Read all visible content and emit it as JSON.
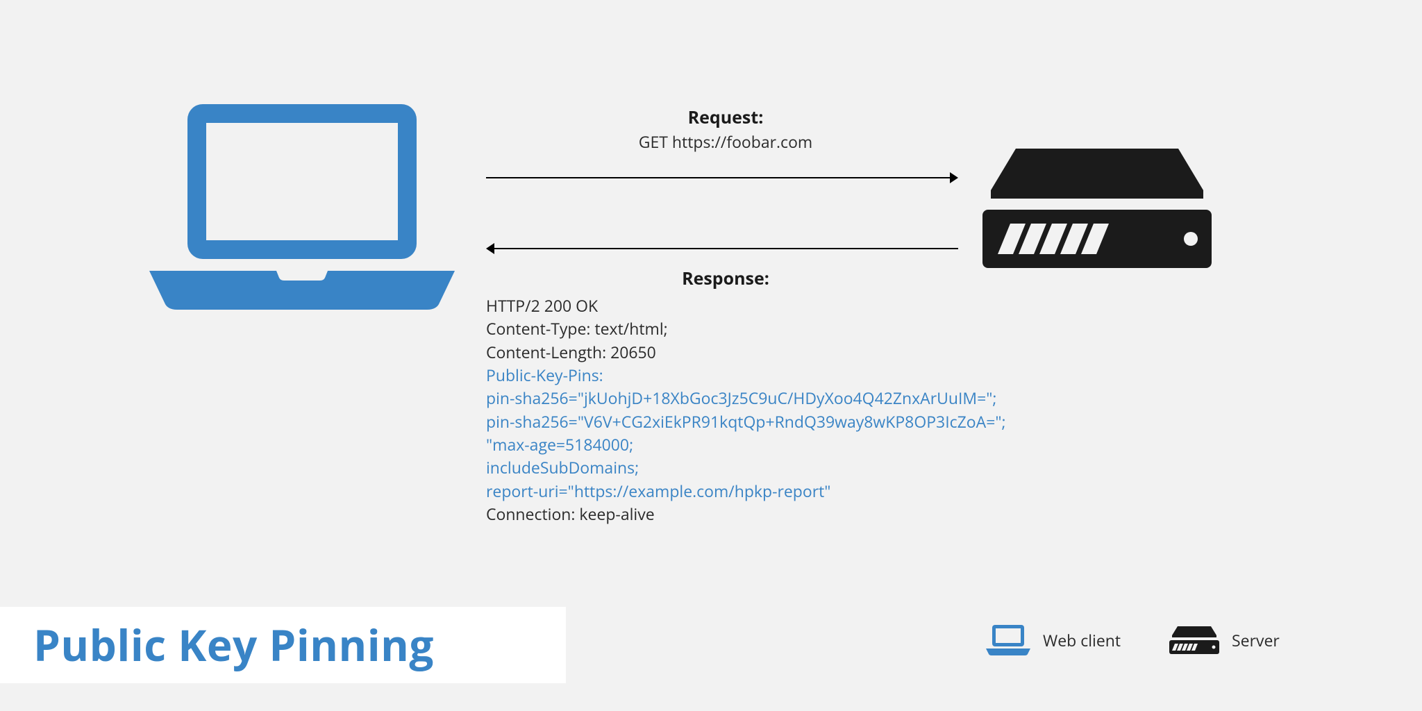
{
  "title": "Public Key Pinning",
  "request": {
    "label": "Request:",
    "value": "GET https://foobar.com"
  },
  "response": {
    "label": "Response:",
    "lines": [
      {
        "text": "HTTP/2 200 OK",
        "highlight": false
      },
      {
        "text": "Content-Type: text/html;",
        "highlight": false
      },
      {
        "text": "Content-Length: 20650",
        "highlight": false
      },
      {
        "text": "Public-Key-Pins:",
        "highlight": true
      },
      {
        "text": "pin-sha256=\"jkUohjD+18XbGoc3Jz5C9uC/HDyXoo4Q42ZnxArUuIM=\";",
        "highlight": true
      },
      {
        "text": "pin-sha256=\"V6V+CG2xiEkPR91kqtQp+RndQ39way8wKP8OP3IcZoA=\";",
        "highlight": true
      },
      {
        "text": "\"max-age=5184000;",
        "highlight": true
      },
      {
        "text": "includeSubDomains;",
        "highlight": true
      },
      {
        "text": "report-uri=\"https://example.com/hpkp-report\"",
        "highlight": true
      },
      {
        "text": "Connection: keep-alive",
        "highlight": false
      }
    ]
  },
  "legend": {
    "client": "Web client",
    "server": "Server"
  },
  "colors": {
    "accent": "#3984c6",
    "black": "#1b1b1b"
  }
}
